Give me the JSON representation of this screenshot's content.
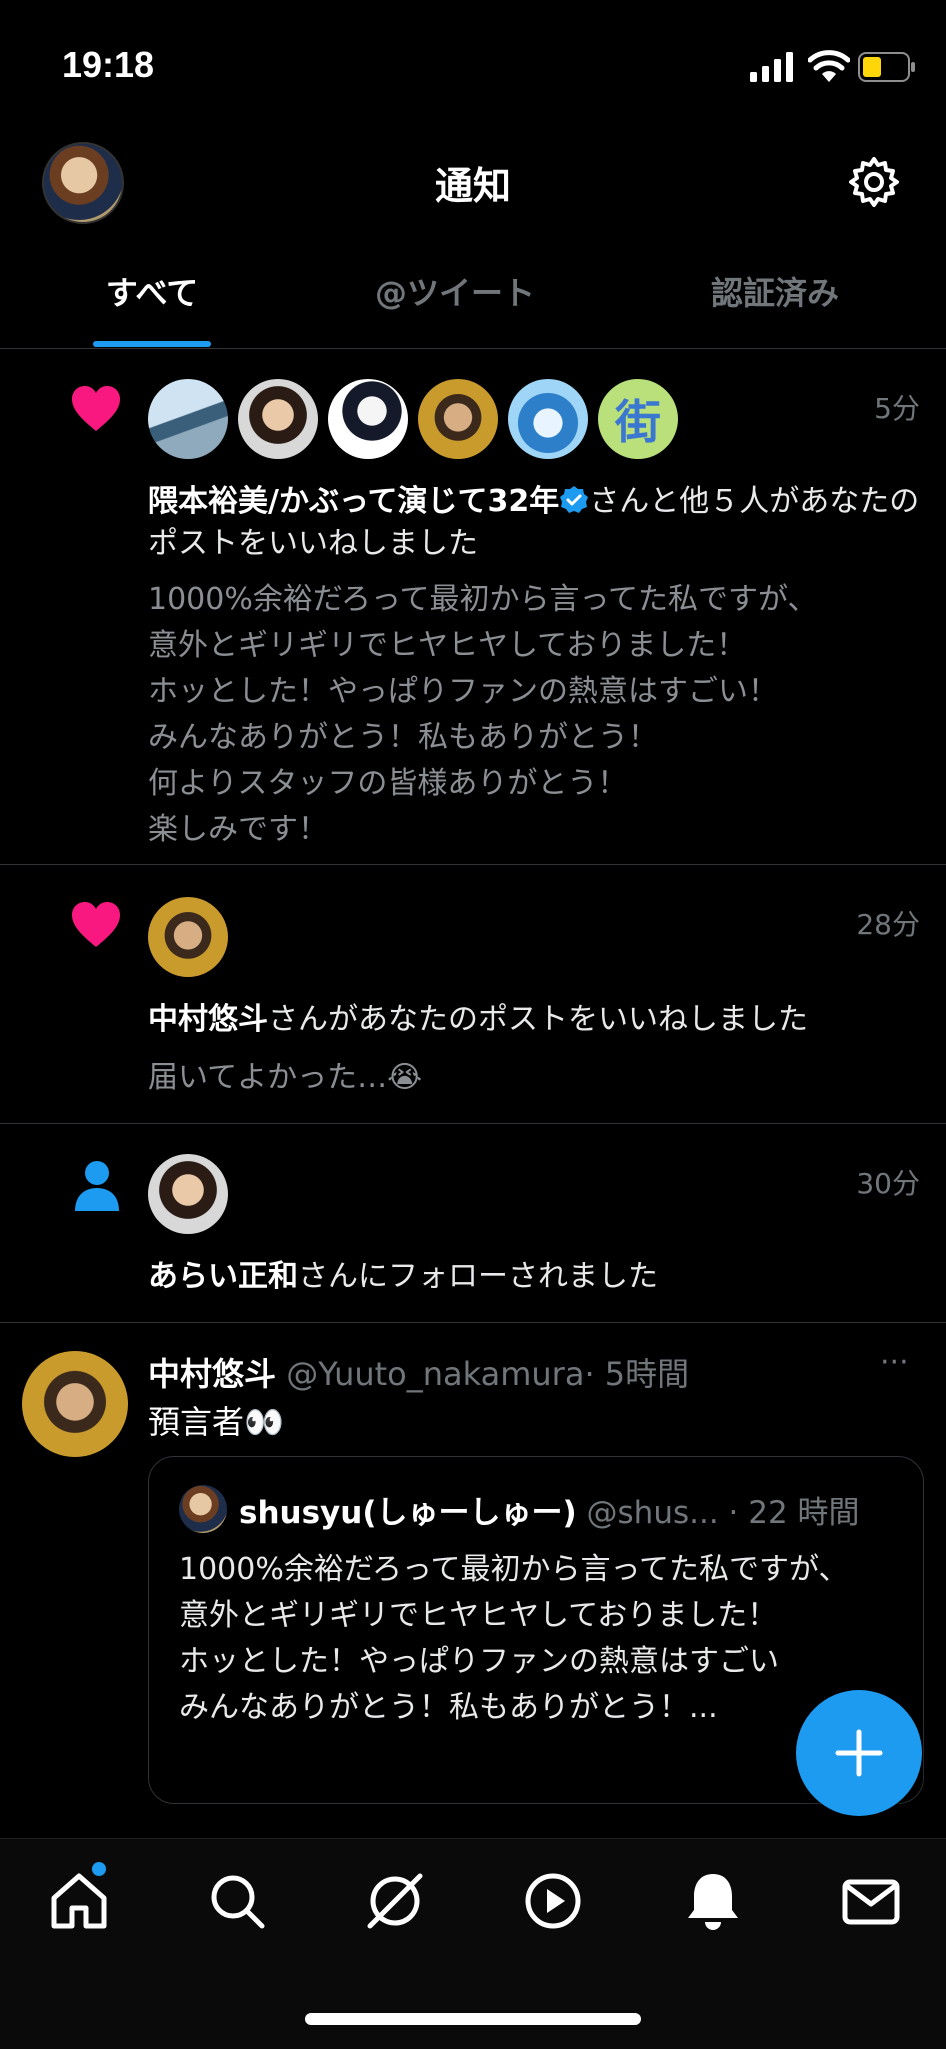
{
  "status_bar": {
    "time": "19:18"
  },
  "header": {
    "title": "通知"
  },
  "tabs": [
    {
      "label": "すべて",
      "active": true
    },
    {
      "label": "@ツイート",
      "active": false
    },
    {
      "label": "認証済み",
      "active": false
    }
  ],
  "notifications": [
    {
      "type": "like",
      "time": "5分",
      "actor_name": "隈本裕美/かぶって演じて32年",
      "verified": true,
      "action_text": "さんと他５人があなたのポストをいいねしました",
      "excerpt": "1000%余裕だろって最初から言ってた私ですが、\n意外とギリギリでヒヤヒヤしておりました！\nホッとした！やっぱりファンの熱意はすごい！\nみんなありがとう！私もありがとう！\n何よりスタッフの皆様ありがとう！\n楽しみです！",
      "avatar_extra_glyph": "街"
    },
    {
      "type": "like",
      "time": "28分",
      "actor_name": "中村悠斗",
      "action_text": "さんがあなたのポストをいいねしました",
      "excerpt": "届いてよかった…😭"
    },
    {
      "type": "follow",
      "time": "30分",
      "actor_name": "あらい正和",
      "action_text": "さんにフォローされました"
    }
  ],
  "tweet": {
    "name": "中村悠斗",
    "handle": "@Yuuto_nakamura",
    "time": "· 5時間",
    "more": "···",
    "text": "預言者👀",
    "quote": {
      "name": "shusyu(しゅーしゅー)",
      "handle": "@shus...",
      "time": "· 22 時間",
      "text": "1000%余裕だろって最初から言ってた私ですが、\n意外とギリギリでヒヤヒヤしておりました！\nホッとした！やっぱりファンの熱意はすごい\nみんなありがとう！私もありがとう！..."
    }
  },
  "fab": {
    "label": "+"
  },
  "nav": [
    {
      "icon": "home-icon",
      "has_badge": true
    },
    {
      "icon": "search-icon"
    },
    {
      "icon": "spaces-icon"
    },
    {
      "icon": "play-icon"
    },
    {
      "icon": "bell-icon"
    },
    {
      "icon": "mail-icon"
    }
  ],
  "colors": {
    "accent": "#1d9bf0",
    "like": "#f91880",
    "background": "#000000"
  }
}
